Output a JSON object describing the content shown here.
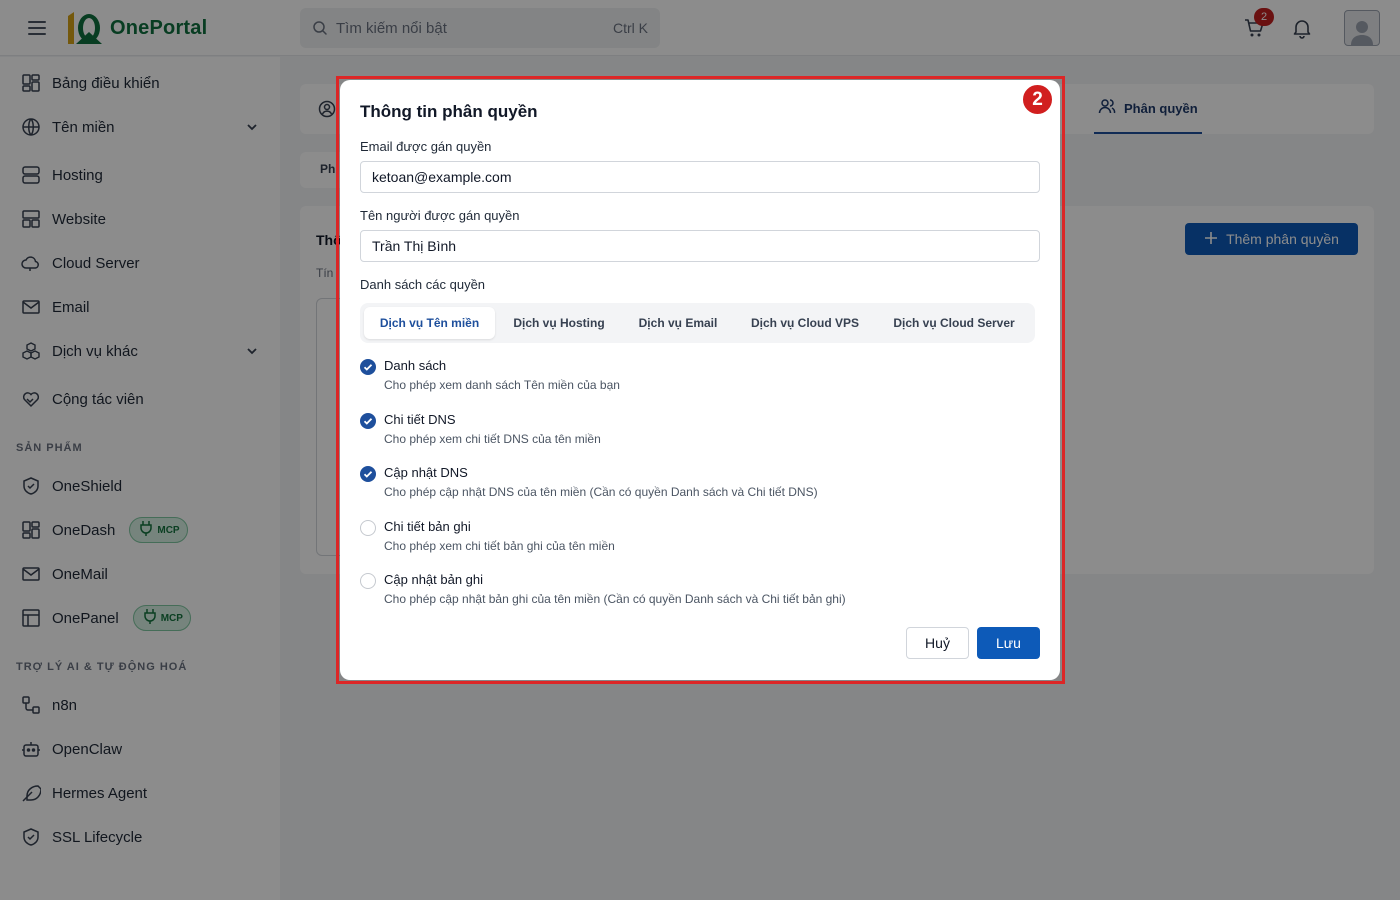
{
  "app": {
    "name": "OnePortal",
    "search_placeholder": "Tìm kiếm nổi bật",
    "search_shortcut": "Ctrl K",
    "cart_count": "2"
  },
  "sidebar": {
    "items": [
      {
        "label": "Bảng điều khiển",
        "icon": "dashboard-icon"
      },
      {
        "label": "Tên miền",
        "icon": "globe-icon",
        "expandable": true
      },
      {
        "label": "Hosting",
        "icon": "server-icon"
      },
      {
        "label": "Website",
        "icon": "website-icon"
      },
      {
        "label": "Cloud Server",
        "icon": "cloud-icon"
      },
      {
        "label": "Email",
        "icon": "mail-icon"
      },
      {
        "label": "Dịch vụ khác",
        "icon": "boxes-icon",
        "expandable": true
      },
      {
        "label": "Cộng tác viên",
        "icon": "handshake-icon"
      }
    ],
    "products_title": "SẢN PHẨM",
    "products": [
      {
        "label": "OneShield",
        "icon": "shield-icon"
      },
      {
        "label": "OneDash",
        "icon": "dashboard-icon",
        "badge": "MCP"
      },
      {
        "label": "OneMail",
        "icon": "mail-icon"
      },
      {
        "label": "OnePanel",
        "icon": "panel-icon",
        "badge": "MCP"
      }
    ],
    "ai_title": "TRỢ LÝ AI & TỰ ĐỘNG HOÁ",
    "ai_items": [
      {
        "label": "n8n",
        "icon": "workflow-icon"
      },
      {
        "label": "OpenClaw",
        "icon": "bot-icon"
      },
      {
        "label": "Hermes Agent",
        "icon": "feather-icon"
      },
      {
        "label": "SSL Lifecycle",
        "icon": "shield-check-icon"
      }
    ]
  },
  "main": {
    "active_tab": "Phân quyền",
    "sub_tab_fragment": "Ph",
    "card_title_fragment": "Thô",
    "card_sub_fragment": "Tín",
    "add_button": "Thêm phân quyền"
  },
  "step_badge": "2",
  "modal": {
    "title": "Thông tin phân quyền",
    "email_label": "Email được gán quyền",
    "email_value": "ketoan@example.com",
    "name_label": "Tên người được gán quyền",
    "name_value": "Trần Thị Bình",
    "perm_list_label": "Danh sách các quyền",
    "tabs": [
      "Dịch vụ Tên miền",
      "Dịch vụ Hosting",
      "Dịch vụ Email",
      "Dịch vụ Cloud VPS",
      "Dịch vụ Cloud Server"
    ],
    "permissions": [
      {
        "name": "Danh sách",
        "desc": "Cho phép xem danh sách Tên miền của bạn",
        "checked": true
      },
      {
        "name": "Chi tiết DNS",
        "desc": "Cho phép xem chi tiết DNS của tên miền",
        "checked": true
      },
      {
        "name": "Cập nhật DNS",
        "desc": "Cho phép cập nhật DNS của tên miền (Cần có quyền Danh sách và Chi tiết DNS)",
        "checked": true
      },
      {
        "name": "Chi tiết bản ghi",
        "desc": "Cho phép xem chi tiết bản ghi của tên miền",
        "checked": false
      },
      {
        "name": "Cập nhật bản ghi",
        "desc": "Cho phép cập nhật bản ghi của tên miền (Cần có quyền Danh sách và Chi tiết bản ghi)",
        "checked": false
      }
    ],
    "cancel_label": "Huỷ",
    "save_label": "Lưu"
  },
  "colors": {
    "primary": "#0d5ab8",
    "brand_green": "#10703f",
    "highlight_red": "#dc2626",
    "checkbox_on": "#1e4f9c"
  }
}
